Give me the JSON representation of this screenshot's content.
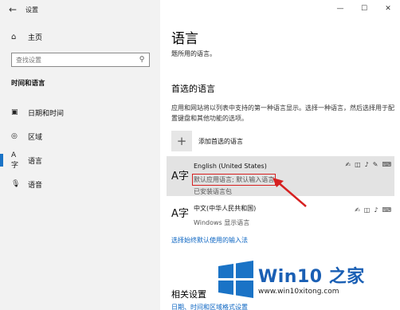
{
  "window": {
    "app_title": "设置",
    "back_icon": "back-arrow-icon",
    "minimize": "—",
    "maximize": "☐",
    "close": "✕"
  },
  "sidebar": {
    "home_label": "主页",
    "search_placeholder": "查找设置",
    "section_title": "时间和语言",
    "items": [
      {
        "label": "日期和时间",
        "icon": "calendar-clock-icon"
      },
      {
        "label": "区域",
        "icon": "globe-icon"
      },
      {
        "label": "语言",
        "icon": "language-icon",
        "active": true
      },
      {
        "label": "语音",
        "icon": "microphone-icon"
      }
    ]
  },
  "main": {
    "title": "语言",
    "subtitle": "题所用的语言。",
    "preferred_heading": "首选的语言",
    "description": "应用和网站将以列表中支持的第一种语言显示。选择一种语言，然后选择用于配置键盘和其他功能的选项。",
    "add_label": "添加首选的语言",
    "languages": [
      {
        "name": "English (United States)",
        "detail": "默认应用语言; 默认输入语言",
        "status": "已安装语言包"
      },
      {
        "name": "中文(中华人民共和国)",
        "detail": "Windows 显示语言"
      }
    ],
    "input_method_link": "选择始终默认使用的输入法",
    "related_heading": "相关设置",
    "related_link": "日期、时间和区域格式设置"
  },
  "watermark": {
    "title": "Win10 之家",
    "url": "www.win10xitong.com"
  },
  "colors": {
    "accent": "#1a73c6",
    "link": "#0a64c2",
    "highlight_box": "#d62020"
  }
}
